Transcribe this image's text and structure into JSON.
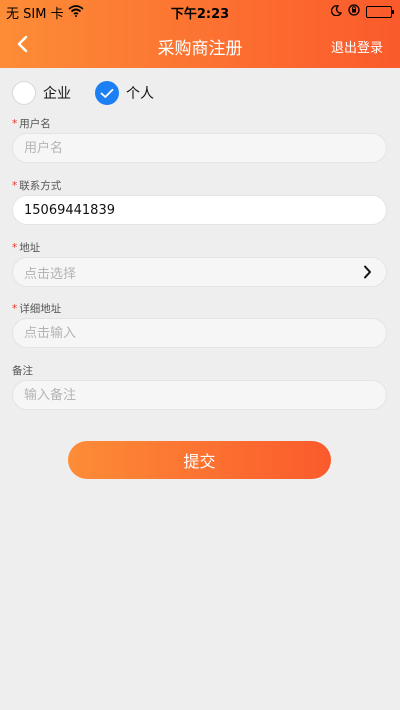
{
  "status_bar": {
    "carrier": "无 SIM 卡",
    "time": "下午2:23"
  },
  "nav": {
    "title": "采购商注册",
    "back_icon": "chevron-left-icon",
    "logout_label": "退出登录"
  },
  "account_type": {
    "options": [
      {
        "label": "企业",
        "selected": false
      },
      {
        "label": "个人",
        "selected": true
      }
    ]
  },
  "form": {
    "username": {
      "label": "用户名",
      "required": true,
      "placeholder": "用户名",
      "value": ""
    },
    "contact": {
      "label": "联系方式",
      "required": true,
      "placeholder": "",
      "value": "15069441839"
    },
    "address": {
      "label": "地址",
      "required": true,
      "placeholder": "点击选择"
    },
    "detail_address": {
      "label": "详细地址",
      "required": true,
      "placeholder": "点击输入",
      "value": ""
    },
    "remark": {
      "label": "备注",
      "required": false,
      "placeholder": "输入备注",
      "value": ""
    }
  },
  "submit_label": "提交",
  "colors": {
    "accent_start": "#fd8c37",
    "accent_end": "#fb5a2c",
    "radio_checked": "#1c7ff3",
    "required_mark": "#e8342c"
  }
}
